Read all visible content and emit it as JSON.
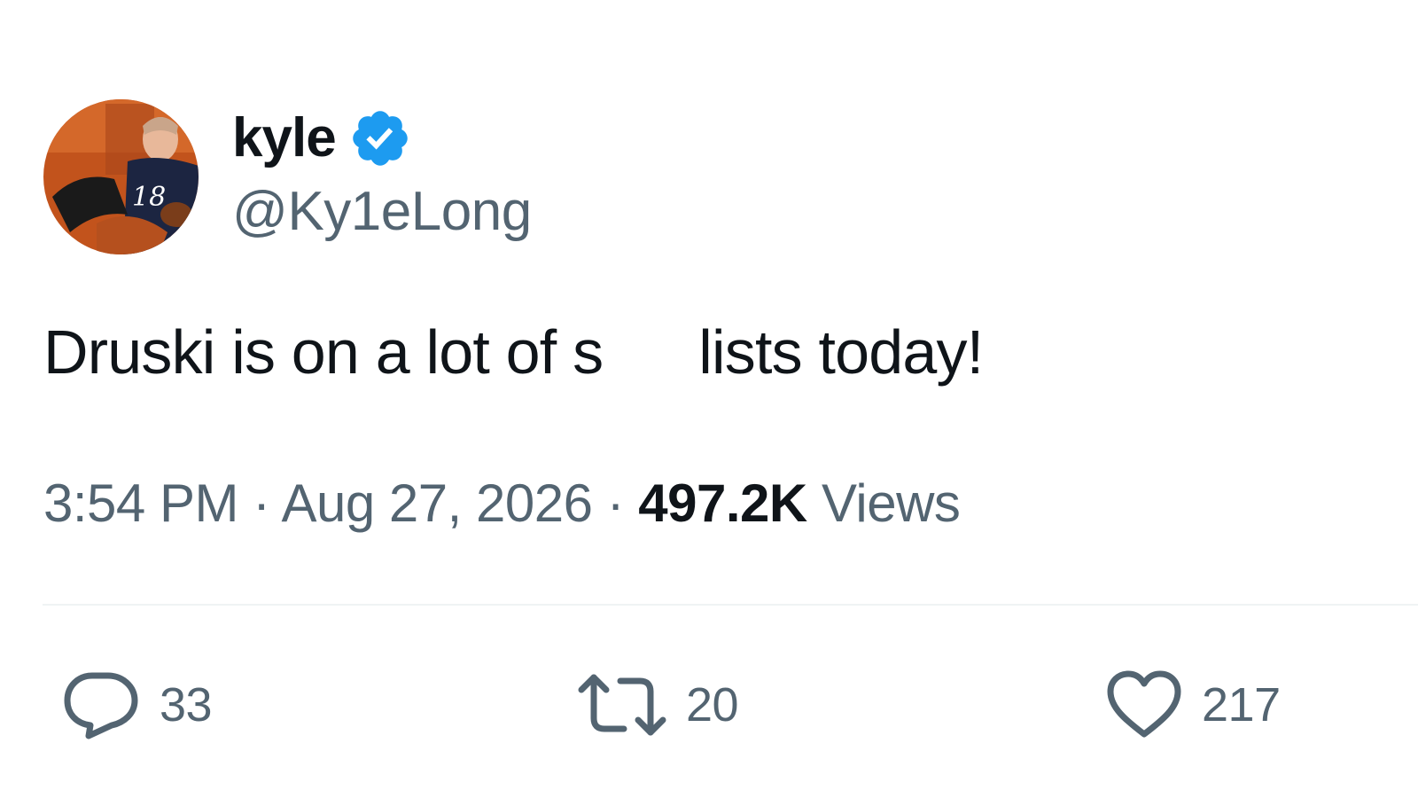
{
  "author": {
    "display_name": "kyle",
    "handle": "@Ky1eLong",
    "verified": true,
    "verified_badge_color": "#1d9bf0",
    "avatar_icon": "profile-photo"
  },
  "tweet": {
    "text_before": "Druski is on a lot of s",
    "text_after": "lists today!"
  },
  "meta": {
    "time": "3:54 PM",
    "separator": " · ",
    "date": "Aug 27, 2026",
    "views_count": "497.2K",
    "views_label": "Views"
  },
  "actions": {
    "reply": {
      "icon": "reply-icon",
      "count": "33"
    },
    "retweet": {
      "icon": "retweet-icon",
      "count": "20"
    },
    "like": {
      "icon": "heart-icon",
      "count": "217"
    }
  },
  "colors": {
    "text_primary": "#0f1419",
    "text_secondary": "#536471",
    "divider": "#eff3f4"
  }
}
